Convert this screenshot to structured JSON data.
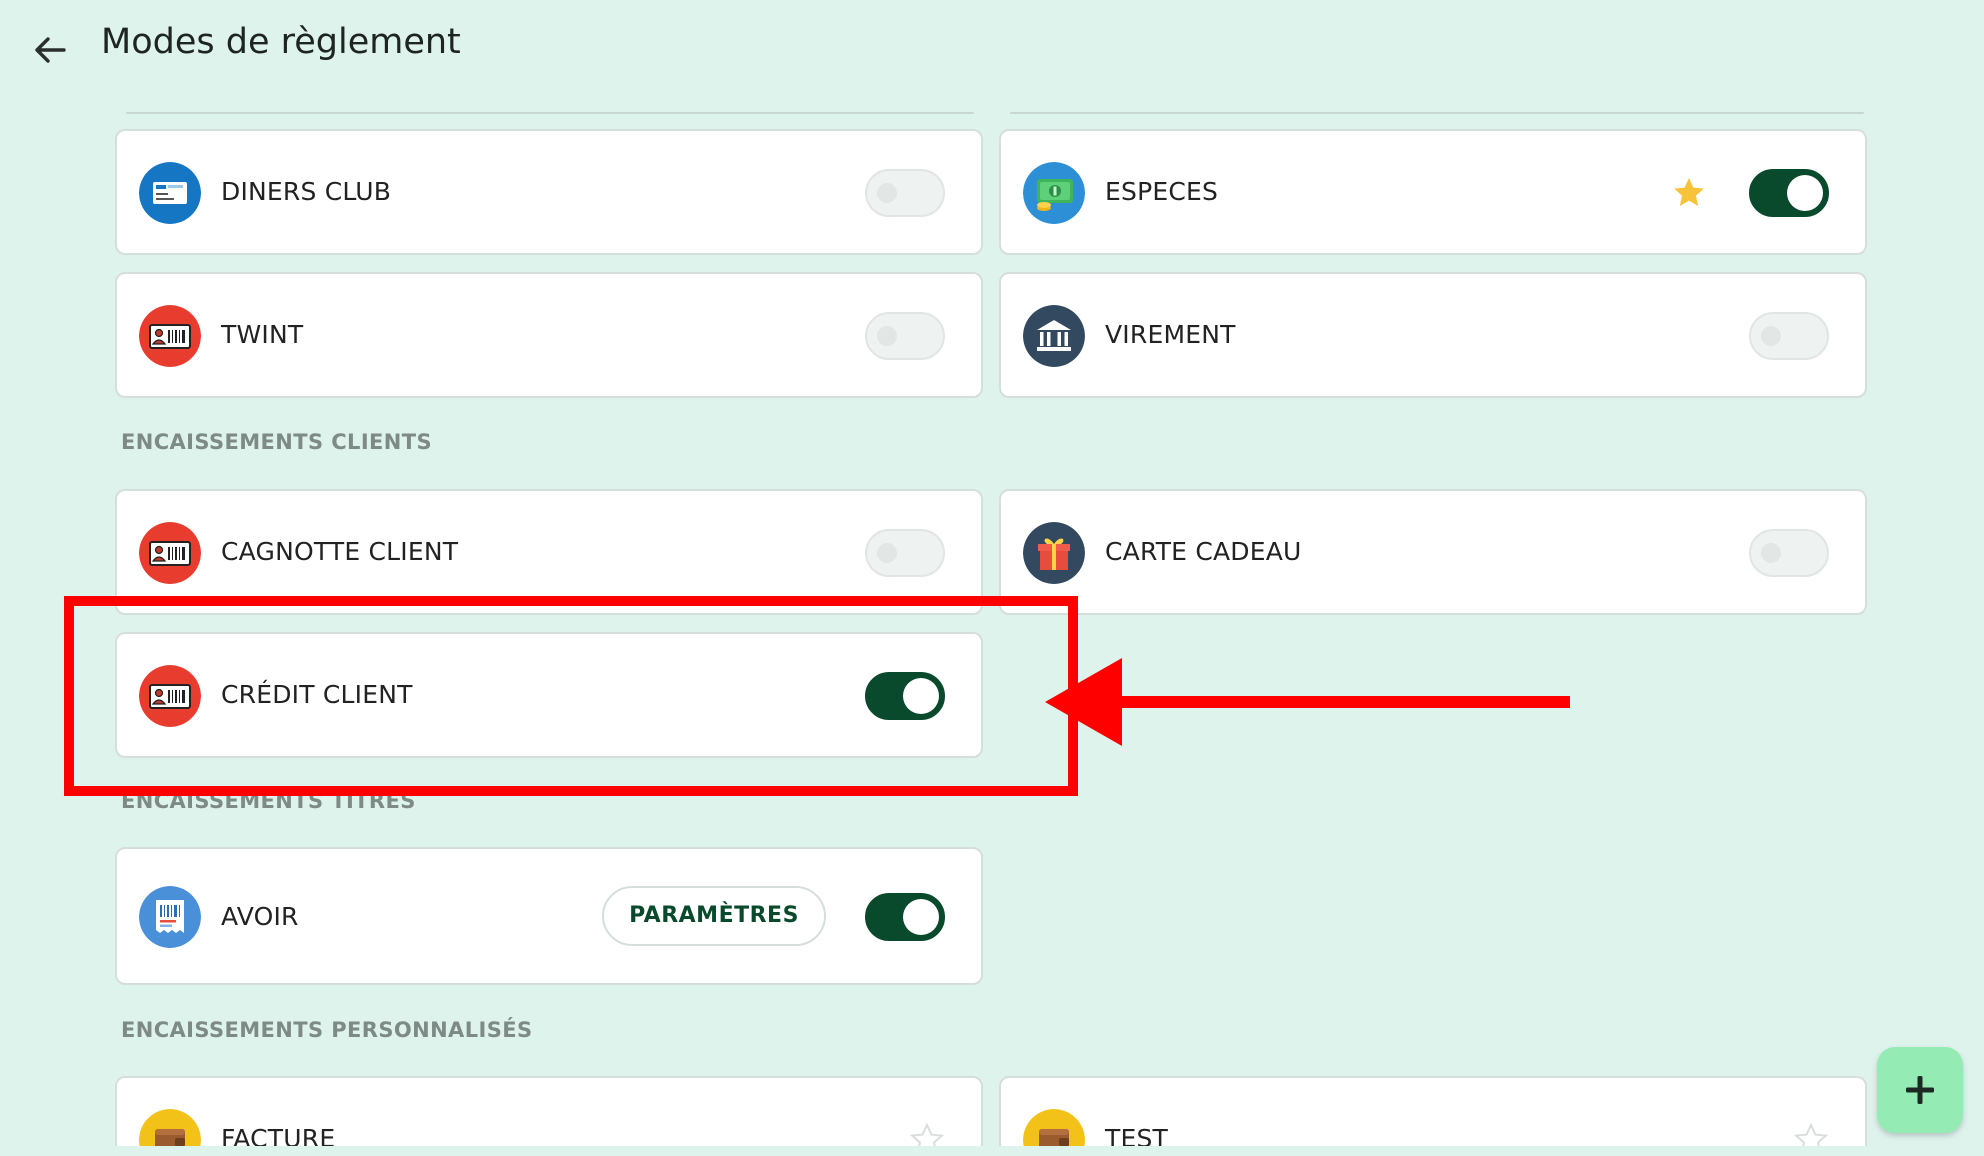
{
  "header": {
    "title": "Modes de règlement",
    "back_icon": "arrow-left-icon"
  },
  "methods_top": [
    {
      "label": "DINERS CLUB",
      "icon": "card-icon",
      "enabled": false,
      "favorite": false
    },
    {
      "label": "ESPECES",
      "icon": "cash-icon",
      "enabled": true,
      "favorite": true
    },
    {
      "label": "TWINT",
      "icon": "id-card-icon",
      "enabled": false,
      "favorite": false
    },
    {
      "label": "VIREMENT",
      "icon": "bank-icon",
      "enabled": false,
      "favorite": false
    }
  ],
  "sections": {
    "clients": "ENCAISSEMENTS CLIENTS",
    "titres": "ENCAISSEMENTS TITRES",
    "personnalises": "ENCAISSEMENTS PERSONNALISÉS"
  },
  "methods_clients": [
    {
      "label": "CAGNOTTE CLIENT",
      "icon": "id-card-icon",
      "enabled": false
    },
    {
      "label": "CARTE CADEAU",
      "icon": "gift-icon",
      "enabled": false
    },
    {
      "label": "CRÉDIT CLIENT",
      "icon": "id-card-icon",
      "enabled": true
    }
  ],
  "methods_titres": [
    {
      "label": "AVOIR",
      "icon": "receipt-icon",
      "enabled": true,
      "button_label": "PARAMÈTRES"
    }
  ],
  "methods_personnalises": [
    {
      "label": "FACTURE",
      "icon": "wallet-icon",
      "favorite": false
    },
    {
      "label": "TEST",
      "icon": "wallet-icon",
      "favorite": false
    }
  ],
  "annotation": {
    "color": "#ff0000",
    "target": "CRÉDIT CLIENT"
  },
  "fab": {
    "icon": "plus-icon",
    "color": "#94ecb4"
  },
  "colors": {
    "background": "#dff3ed",
    "toggle_on": "#0a4a2c",
    "star": "#f7c33b",
    "accent_text": "#0a4a2c"
  }
}
